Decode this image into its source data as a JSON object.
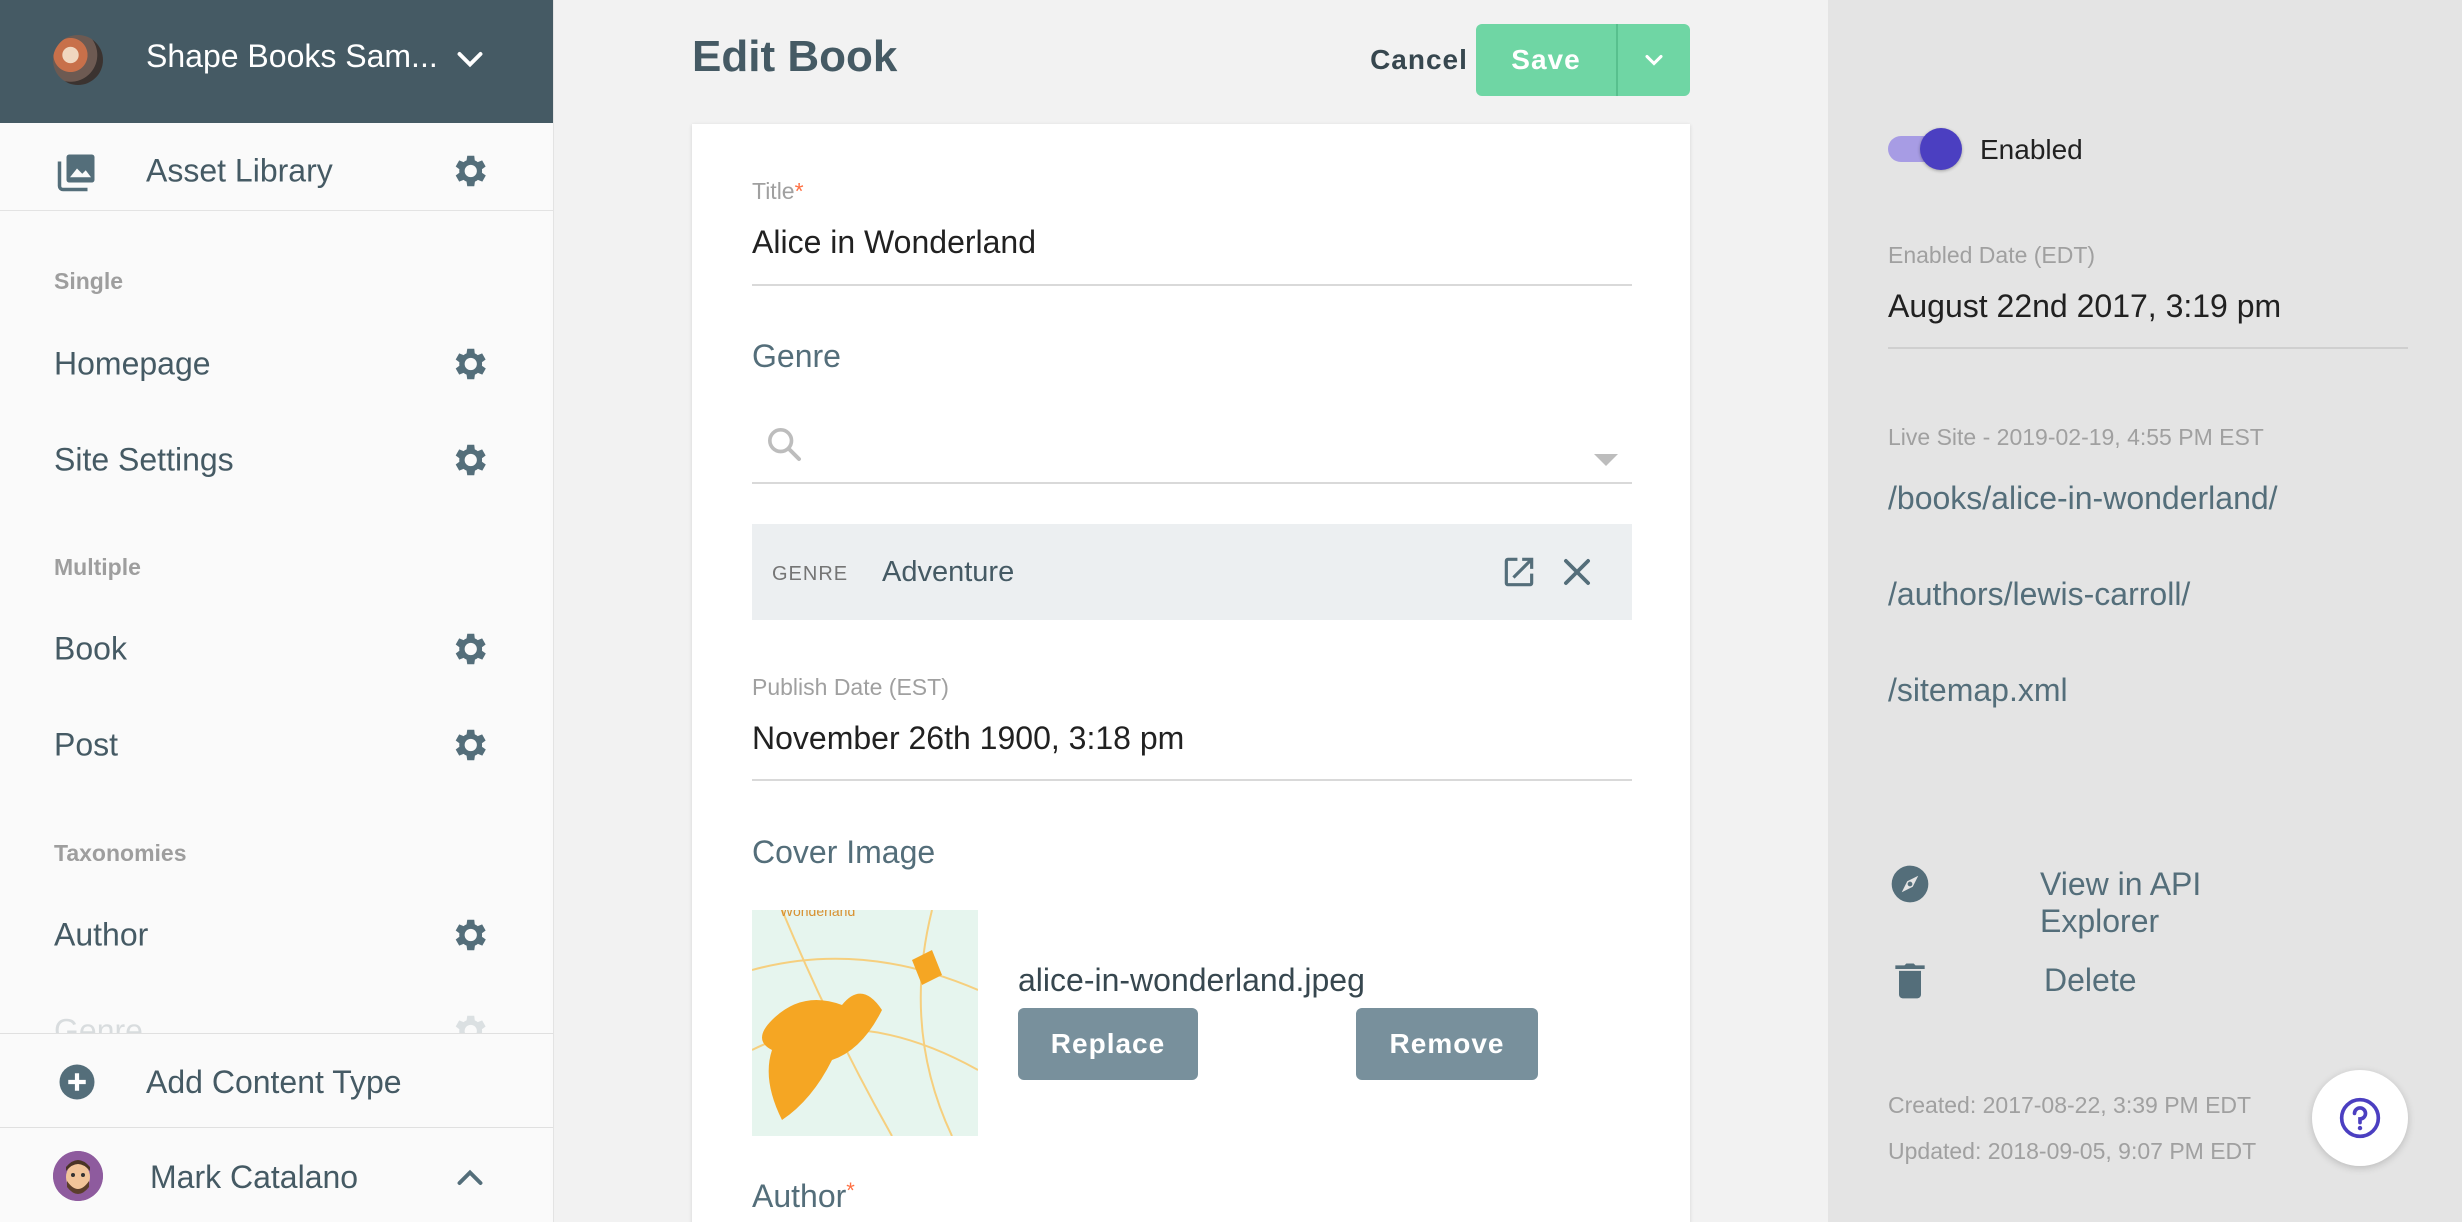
{
  "sidebar": {
    "project_name": "Shape Books Sam...",
    "asset_library": "Asset Library",
    "sections": {
      "single": "Single",
      "multiple": "Multiple",
      "taxonomies": "Taxonomies"
    },
    "single_items": [
      "Homepage",
      "Site Settings"
    ],
    "multiple_items": [
      "Book",
      "Post"
    ],
    "taxonomy_items": [
      "Author",
      "Genre"
    ],
    "add_content_type": "Add Content Type",
    "user_name": "Mark Catalano"
  },
  "header": {
    "title": "Edit Book",
    "cancel_label": "Cancel",
    "save_label": "Save"
  },
  "form": {
    "title_label": "Title",
    "title_required": "*",
    "title_value": "Alice in Wonderland",
    "genre_label": "Genre",
    "genre_search_placeholder": "",
    "genre_chip": {
      "type": "GENRE",
      "name": "Adventure"
    },
    "publish_date_label": "Publish Date (EST)",
    "publish_date_value": "November 26th 1900, 3:18 pm",
    "cover_image_label": "Cover Image",
    "cover_thumb_text": "Wonderland",
    "cover_filename": "alice-in-wonderland.jpeg",
    "replace_label": "Replace",
    "remove_label": "Remove",
    "author_label": "Author",
    "author_required": "*"
  },
  "right_panel": {
    "enabled_label": "Enabled",
    "enabled_on": true,
    "enabled_date_label": "Enabled Date (EDT)",
    "enabled_date_value": "August 22nd 2017, 3:19 pm",
    "live_site_label": "Live Site - 2019-02-19, 4:55 PM EST",
    "live_urls": [
      "/books/alice-in-wonderland/",
      "/authors/lewis-carroll/",
      "/sitemap.xml"
    ],
    "view_api_label": "View in API Explorer",
    "delete_label": "Delete",
    "created": "Created: 2017-08-22, 3:39 PM EDT",
    "updated": "Updated: 2018-09-05, 9:07 PM EDT"
  },
  "colors": {
    "sidebar_header": "#455a64",
    "save_button": "#6fd6a4",
    "toggle_on": "#4b3fc1",
    "secondary_button": "#78909c",
    "required_asterisk": "#ff7043"
  },
  "icons": {
    "project_avatar": "project-avatar",
    "asset_library": "image-icon",
    "settings": "gear-icon",
    "add": "plus-circle-icon",
    "search": "search-icon",
    "open_external": "open-in-new-icon",
    "close": "close-icon",
    "api_explorer": "compass-icon",
    "delete": "trash-icon",
    "help": "question-icon"
  }
}
